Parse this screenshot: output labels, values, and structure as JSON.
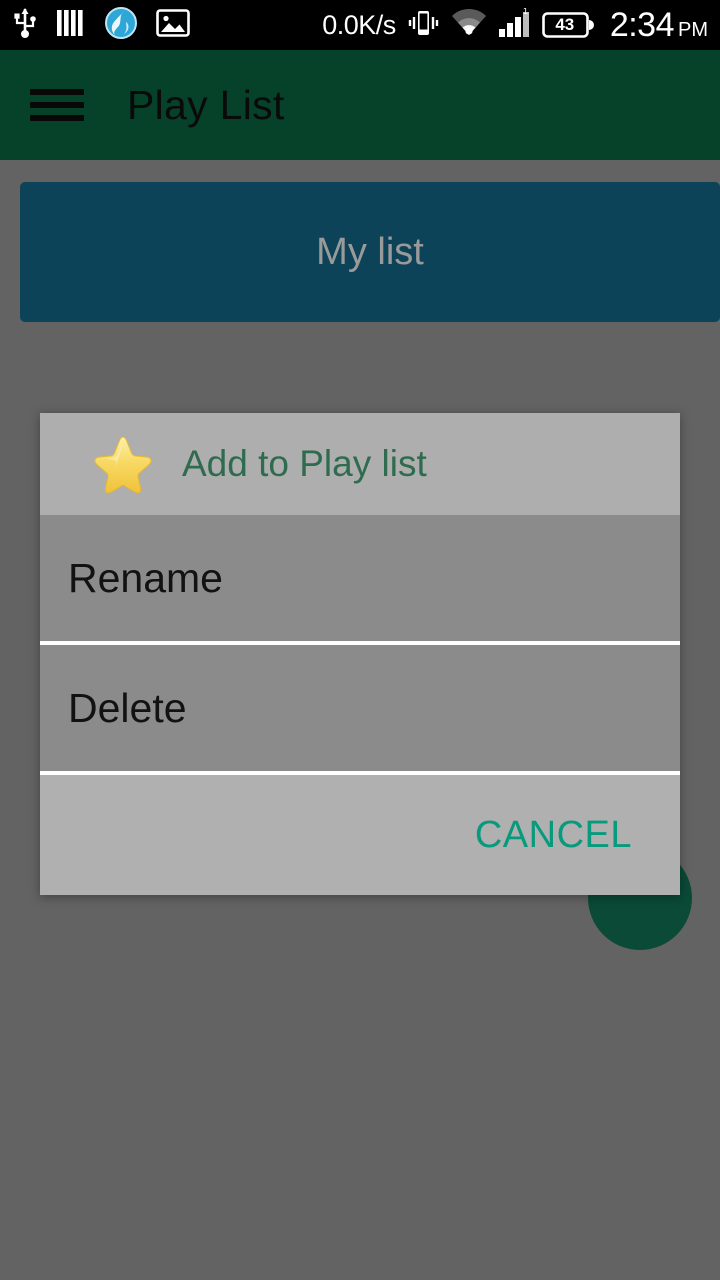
{
  "status_bar": {
    "icons_left": [
      "usb-icon",
      "bars-icon",
      "browser-icon",
      "gallery-icon"
    ],
    "network_speed": "0.0K/s",
    "vibrate_icon": "vibrate-icon",
    "wifi_icon": "wifi-icon",
    "signal_icon": "signal-bars-icon",
    "signal_sim_label": "1",
    "battery_level": "43",
    "time": "2:34",
    "ampm": "PM"
  },
  "app_bar": {
    "menu_icon": "hamburger-menu-icon",
    "title": "Play List"
  },
  "main": {
    "playlist_card_label": "My list",
    "fab_label": ""
  },
  "dialog": {
    "header_icon": "star-icon",
    "title": "Add to Play list",
    "items": [
      {
        "label": "Rename"
      },
      {
        "label": "Delete"
      }
    ],
    "cancel_label": "CANCEL"
  },
  "colors": {
    "app_bar_green": "#06422a",
    "card_teal": "#0d4359",
    "scrim_gray": "#636363",
    "dialog_header_gray": "#aeaeae",
    "dialog_body_gray": "#8b8b8b",
    "dialog_footer_gray": "#b0b0b0",
    "accent_teal": "#079a7c",
    "dialog_title_green": "#2f6b4f",
    "fab_green": "#0a4a36",
    "star_gold": "#f5cf52"
  }
}
